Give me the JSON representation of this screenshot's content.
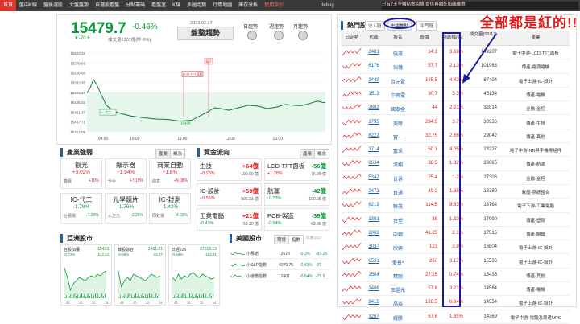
{
  "nav": {
    "items": [
      "首頁",
      "盤中K線",
      "盤後選股",
      "大盤盤勢",
      "自選股看盤",
      "分點籌碼",
      "看盤室",
      "K線",
      "多圖走勢",
      "行情地圖",
      "庫存分析",
      "使用指引"
    ],
    "debug": "debug",
    "promo": "只有7天全額點數回饋 提供再額外加碼優惠"
  },
  "index": {
    "value": "15479.7",
    "change_pct": "-0.46%",
    "change_pts": "▼-70.8",
    "volume": "成交量2101億(昨-5%)",
    "date": "2023.02.17",
    "trend_label": "盤整趨勢",
    "signals": [
      "日趨勢",
      "週趨勢",
      "月趨勢"
    ]
  },
  "intraday_chart": {
    "y_ticks": [
      "15603.32",
      "15579.66",
      "15556.00",
      "15532.35",
      "15508.69",
      "15485.03",
      "15461.37",
      "15437.71",
      "15414.05"
    ],
    "x_ticks": [
      "09:00",
      "10:00",
      "11:00",
      "12:00",
      "13:00"
    ],
    "ylim": [
      15414.05,
      15603.32
    ],
    "annotations": [
      "LCD-TFT面板",
      "電子"
    ],
    "left_annotation": "IC-代工",
    "low_label": "15438"
  },
  "sectors": {
    "title": "產業強弱",
    "tabs": [
      "產業",
      "概念"
    ],
    "cards": [
      {
        "name": "觀光",
        "pct": "+3.02%",
        "sub_l": "春晨",
        "sub_r": "+10%"
      },
      {
        "name": "顯示器",
        "pct": "+1.94%",
        "sub_l": "全台",
        "sub_r": "+7.19%"
      },
      {
        "name": "商業自動",
        "pct": "+1.8%",
        "sub_l": "綠意",
        "sub_r": "+9.08%"
      },
      {
        "name": "IC-代工",
        "pct": "-1.78%",
        "sub_l": "台積電",
        "sub_r": "-1.89%"
      },
      {
        "name": "光學鏡片",
        "pct": "-1.76%",
        "sub_l": "大立光",
        "sub_r": "-2.26%"
      },
      {
        "name": "IC-封測",
        "pct": "-1.42%",
        "sub_l": "同致電",
        "sub_r": "-4.03%"
      }
    ]
  },
  "flows": {
    "title": "資金流向",
    "tabs": [
      "產業",
      "概念"
    ],
    "cards": [
      {
        "name": "生技",
        "val": "+64億",
        "pct": "+0.26%",
        "amt": "199.90 億"
      },
      {
        "name": "LCD-TFT面板",
        "val": "-56億",
        "pct": "+1.28%",
        "amt": "76.09 億"
      },
      {
        "name": "IC-設計",
        "val": "+59億",
        "pct": "+0.55%",
        "amt": "506.21 億"
      },
      {
        "name": "航運",
        "val": "-42億",
        "pct": "-0.73%",
        "amt": "100.68 億"
      },
      {
        "name": "工業電腦",
        "val": "+21億",
        "pct": "-0.43%",
        "amt": "53.30 億"
      },
      {
        "name": "PCB-製造",
        "val": "-39億",
        "pct": "-0.54%",
        "amt": "63.05 億"
      }
    ]
  },
  "asia": {
    "title": "亞洲股市",
    "cards": [
      {
        "name": "台股加權",
        "val": "15433",
        "chg": "-0.73%",
        "pts": "-113.14"
      },
      {
        "name": "韓股綜合",
        "val": "2451.21",
        "chg": "-0.68%",
        "pts": "-24.27"
      },
      {
        "name": "日經225",
        "val": "27513.13",
        "chg": "-0.66%",
        "pts": "-183.31"
      }
    ],
    "x_ticks": [
      "08",
      "10",
      "12",
      "14"
    ]
  },
  "us": {
    "title": "美國股市",
    "tabs": [
      "期貨",
      "指數"
    ],
    "time": "日期:2/17",
    "rows": [
      {
        "name": "小那斯",
        "val": "12628",
        "chg": "-0.3%",
        "pts": "-39.25"
      },
      {
        "name": "小S&P指數",
        "val": "4079.75",
        "chg": "-0.49%",
        "pts": "-20"
      },
      {
        "name": "小道瓊指數",
        "val": "12401",
        "chg": "-0.64%",
        "pts": "-79.5"
      }
    ]
  },
  "hot": {
    "title": "熱門股",
    "tabs": [
      "法人股",
      "市場焦點",
      "冷門股"
    ],
    "columns": [
      "日走勢",
      "代碼",
      "股名",
      "股價",
      "漲跌幅(%)",
      "成交量(02/17)",
      "產業"
    ],
    "rows": [
      {
        "code": "2481",
        "name": "強茂",
        "price": "14.1",
        "pc": "3.68%",
        "vol": "149207",
        "ind": "電子中游-LCD-TFT面板"
      },
      {
        "code": "6176",
        "name": "瑞儀",
        "price": "57.7",
        "pc": "2.13%",
        "vol": "101963",
        "ind": "傳產-電源電機"
      },
      {
        "code": "2449",
        "name": "京元電",
        "price": "165.5",
        "pc": "4.42%",
        "vol": "87404",
        "ind": "電子上游-IC-設計"
      },
      {
        "code": "1513",
        "name": "中興電",
        "price": "90.7",
        "pc": "3.3%",
        "vol": "45134",
        "ind": "傳產-電機"
      },
      {
        "code": "2882",
        "name": "國泰金",
        "price": "44",
        "pc": "2.21%",
        "vol": "32814",
        "ind": "金融-金控"
      },
      {
        "code": "1795",
        "name": "美時",
        "price": "294.5",
        "pc": "3.7%",
        "vol": "30936",
        "ind": "傳產-生技"
      },
      {
        "code": "8222",
        "name": "寶一",
        "price": "32.75",
        "pc": "2.66%",
        "vol": "29042",
        "ind": "傳產-其他"
      },
      {
        "code": "3714",
        "name": "富采",
        "price": "50.1",
        "pc": "4.05%",
        "vol": "28227",
        "ind": "電子中游-NB與手機零組件"
      },
      {
        "code": "2634",
        "name": "漢翔",
        "price": "38.5",
        "pc": "1.32%",
        "vol": "28065",
        "ind": "傳產-航運"
      },
      {
        "code": "5347",
        "name": "世界",
        "price": "25.4",
        "pc": "1.2%",
        "vol": "27306",
        "ind": "金融-金控"
      },
      {
        "code": "2471",
        "name": "資通",
        "price": "49.2",
        "pc": "1.65%",
        "vol": "18780",
        "ind": "軟體-系統整合"
      },
      {
        "code": "6213",
        "name": "聯茂",
        "price": "114.5",
        "pc": "8.53%",
        "vol": "18764",
        "ind": "電子下游-工業電腦"
      },
      {
        "code": "1301",
        "name": "台塑",
        "price": "38",
        "pc": "1.33%",
        "vol": "17990",
        "ind": "傳產-塑膠"
      },
      {
        "code": "2002",
        "name": "中鋼",
        "price": "41.25",
        "pc": "2.1%",
        "vol": "17515",
        "ind": "傳產-鋼鐵"
      },
      {
        "code": "3037",
        "name": "欣興",
        "price": "123",
        "pc": "3.8%",
        "vol": "16804",
        "ind": "電子上游-IC-設計"
      },
      {
        "code": "6531",
        "name": "愛普*",
        "price": "260",
        "pc": "3.17%",
        "vol": "15536",
        "ind": "電子上游-IC-設計"
      },
      {
        "code": "1584",
        "name": "精剛",
        "price": "27.15",
        "pc": "0.74%",
        "vol": "15438",
        "ind": "傳產-其他"
      },
      {
        "code": "3406",
        "name": "玉晶光",
        "price": "57.8",
        "pc": "3.21%",
        "vol": "14564",
        "ind": "傳產-電機"
      },
      {
        "code": "8415",
        "name": "晶焱",
        "price": "128.5",
        "pc": "6.64%",
        "vol": "14554",
        "ind": "電子上游-IC-設計"
      },
      {
        "code": "3207",
        "name": "耀勝",
        "price": "67.6",
        "pc": "1.35%",
        "vol": "14369",
        "ind": "電子中游-電腦及周邊UPS"
      }
    ]
  },
  "annotation": "全部都是紅的!!",
  "colors": {
    "up": "#e02020",
    "down": "#0a9a3a",
    "accent": "#1e5fa8",
    "nav_active": "#d9362b"
  }
}
